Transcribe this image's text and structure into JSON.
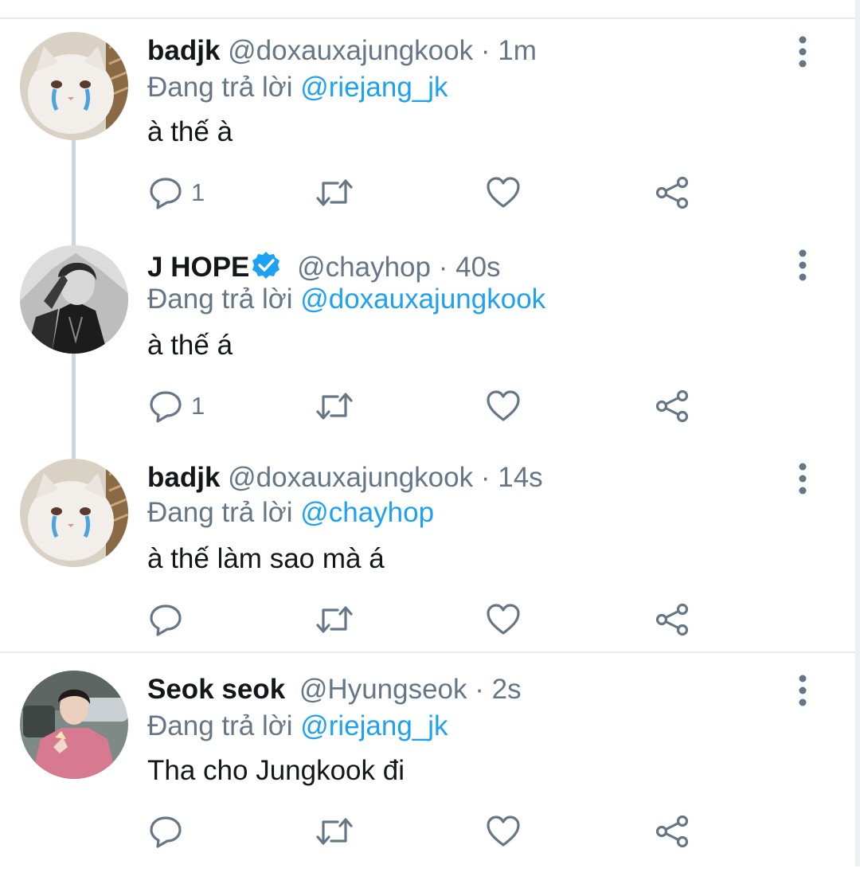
{
  "icons": {
    "reply": "speech-bubble-icon",
    "retweet": "retweet-arrows-icon",
    "like": "heart-outline-icon",
    "share": "share-nodes-icon",
    "more": "vertical-ellipsis-icon",
    "verified": "verified-badge-icon"
  },
  "colors": {
    "mention": "#1da1f2",
    "secondary_text": "#657786",
    "primary_text": "#14171a",
    "verified": "#1da1f2"
  },
  "replying_prefix": "Đang trả lời",
  "tweets": [
    {
      "name": "badjk",
      "handle": "@doxauxajungkook",
      "time": "· 1m",
      "reply_to": "@riejang_jk",
      "text": "à thế à",
      "reply_count": "1",
      "avatar": "crying-cat-avatar"
    },
    {
      "name": "J HOPE",
      "verified": true,
      "handle": "@chayhop",
      "time": "· 40s",
      "reply_to": "@doxauxajungkook",
      "text": "à thế á",
      "reply_count": "1",
      "avatar": "black-white-portrait-avatar"
    },
    {
      "name": "badjk",
      "handle": "@doxauxajungkook",
      "time": "· 14s",
      "reply_to": "@chayhop",
      "text": "à thế làm sao mà á",
      "reply_count": "",
      "avatar": "crying-cat-avatar"
    },
    {
      "name": "Seok seok",
      "handle": "@Hyungseok",
      "time": "· 2s",
      "reply_to": "@riejang_jk",
      "text": "Tha cho Jungkook đi",
      "reply_count": "",
      "avatar": "pink-sweater-person-avatar"
    }
  ]
}
